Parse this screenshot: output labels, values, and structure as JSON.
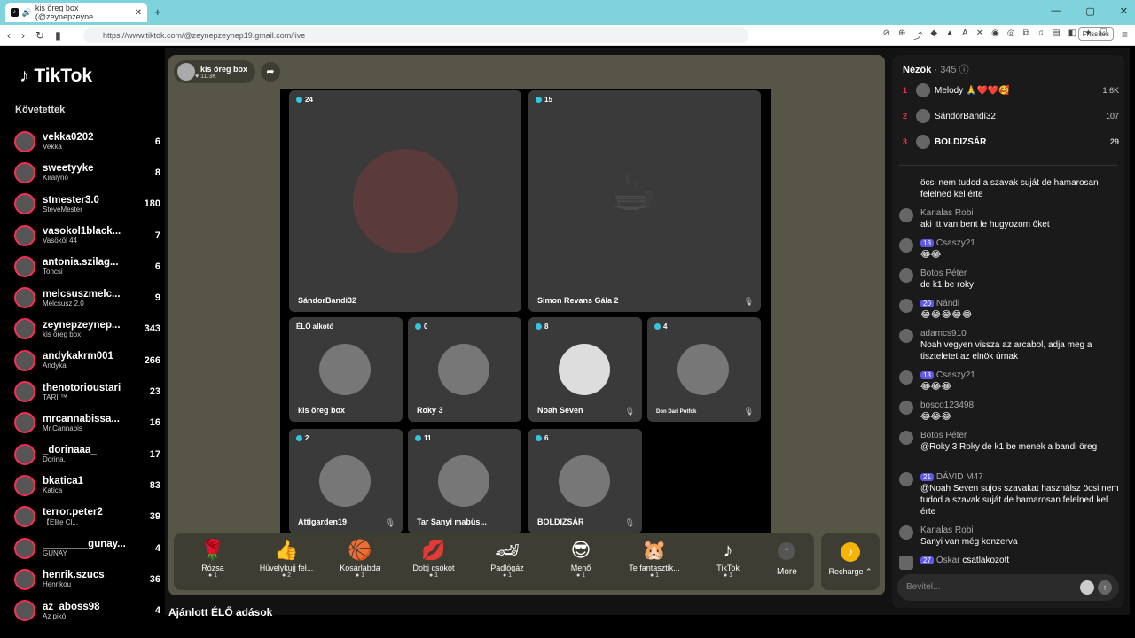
{
  "browser": {
    "tab_title": "kis öreg box (@zeynepzeyne...",
    "url": "https://www.tiktok.com/@zeynepzeynep19.gmail.com/live",
    "refresh_label": "Frissítés"
  },
  "sidebar": {
    "logo": "TikTok",
    "following_header": "Követettek",
    "items": [
      {
        "name": "vekka0202",
        "sub": "Vekka",
        "count": "6"
      },
      {
        "name": "sweetyyke",
        "sub": "Királynő",
        "count": "8"
      },
      {
        "name": "stmester3.0",
        "sub": "SteveMester",
        "count": "180"
      },
      {
        "name": "vasokol1black...",
        "sub": "Vasököl 44",
        "count": "7"
      },
      {
        "name": "antonia.szilag...",
        "sub": "Toncsi",
        "count": "6"
      },
      {
        "name": "melcsuszmelc...",
        "sub": "Melcsusz 2.0",
        "count": "9"
      },
      {
        "name": "zeynepzeynep...",
        "sub": "kis öreg box",
        "count": "343"
      },
      {
        "name": "andykakrm001",
        "sub": "Andyka",
        "count": "266"
      },
      {
        "name": "thenotorioustari",
        "sub": "TARI ™",
        "count": "23"
      },
      {
        "name": "mrcannabissa...",
        "sub": "Mr.Cannabis",
        "count": "16"
      },
      {
        "name": "_dorinaaa_",
        "sub": "Dorina.",
        "count": "17"
      },
      {
        "name": "bkatica1",
        "sub": "Katica",
        "count": "83"
      },
      {
        "name": "terror.peter2",
        "sub": "【Elite Cl...",
        "count": "39"
      },
      {
        "name": "________gunay...",
        "sub": "GUNAY",
        "count": "4"
      },
      {
        "name": "henrik.szucs",
        "sub": "Henrikou",
        "count": "36"
      },
      {
        "name": "az_aboss98",
        "sub": "Az pikó",
        "count": "4"
      }
    ]
  },
  "host": {
    "title": "kis öreg box",
    "likes": "11.3K"
  },
  "cells": [
    {
      "count": "24",
      "name": "SándorBandi32"
    },
    {
      "count": "15",
      "name": "Simon Revans Gála 2"
    },
    {
      "count": "ÉLŐ alkotó",
      "name": "kis öreg box"
    },
    {
      "count": "0",
      "name": "Roky 3"
    },
    {
      "count": "8",
      "name": "Noah Seven"
    },
    {
      "count": "4",
      "name": "Don Dari Potfok"
    },
    {
      "count": "2",
      "name": "Attigarden19"
    },
    {
      "count": "11",
      "name": "Tar Sanyi mabüs..."
    },
    {
      "count": "6",
      "name": "BOLDIZSÁR"
    }
  ],
  "gifts": [
    {
      "name": "Rózsa",
      "price": "1",
      "icon": "🌹"
    },
    {
      "name": "Hüvelykujj fel...",
      "price": "2",
      "icon": "👍"
    },
    {
      "name": "Kosárlabda",
      "price": "1",
      "icon": "🏀"
    },
    {
      "name": "Dobj csókot",
      "price": "1",
      "icon": "💋"
    },
    {
      "name": "Padlógáz",
      "price": "1",
      "icon": "🏎"
    },
    {
      "name": "Menő",
      "price": "1",
      "icon": "😎"
    },
    {
      "name": "Te fantasztik...",
      "price": "1",
      "icon": "🐹"
    },
    {
      "name": "TikTok",
      "price": "1",
      "icon": "♪"
    }
  ],
  "more_label": "More",
  "recharge_label": "Recharge",
  "recommend_label": "Ajánlott ÉLŐ adások",
  "viewers": {
    "header": "Nézők",
    "count": "· 345",
    "top": [
      {
        "rank": "1",
        "name": "Melody 🙏❤️❤️🥰",
        "count": "1.6K"
      },
      {
        "rank": "2",
        "name": "SándorBandi32",
        "count": "107"
      },
      {
        "rank": "3",
        "name": "BOLDIZSÁR",
        "count": "29"
      }
    ]
  },
  "messages": [
    {
      "user": "",
      "level": "",
      "text": "öcsi nem tudod a szavak suját de hamarosan felelned kel érte"
    },
    {
      "user": "Kanalas Robi",
      "level": "",
      "text": "aki itt van bent le hugyozom őket"
    },
    {
      "user": "Csaszy21",
      "level": "13",
      "text": "😂😂"
    },
    {
      "user": "Botos Péter",
      "level": "",
      "text": "de k1 be roky"
    },
    {
      "user": "Nándi",
      "level": "20",
      "text": "😂😂😂😂😂"
    },
    {
      "user": "adamcs910",
      "level": "",
      "text": "Noah vegyen vissza az arcabol, adja meg a tiszteletet az elnök úrnak"
    },
    {
      "user": "Csaszy21",
      "level": "13",
      "text": "😂😂😂"
    },
    {
      "user": "bosco123498",
      "level": "",
      "text": "😂😂😂"
    },
    {
      "user": "Botos Péter",
      "level": "",
      "text": "@Roky 3 Roky de k1 be menek a bandi öreg"
    },
    {
      "user": "DÁVID M47",
      "level": "21",
      "text": "@Noah Seven sujos szavakat használsz öcsi nem tudod a szavak suját de hamarosan felelned kel érte"
    },
    {
      "user": "Kanalas Robi",
      "level": "",
      "text": "Sanyi van még konzerva"
    },
    {
      "user": "Oskar",
      "level": "27",
      "text": "csatlakozott"
    }
  ],
  "input_placeholder": "Bevitel..."
}
